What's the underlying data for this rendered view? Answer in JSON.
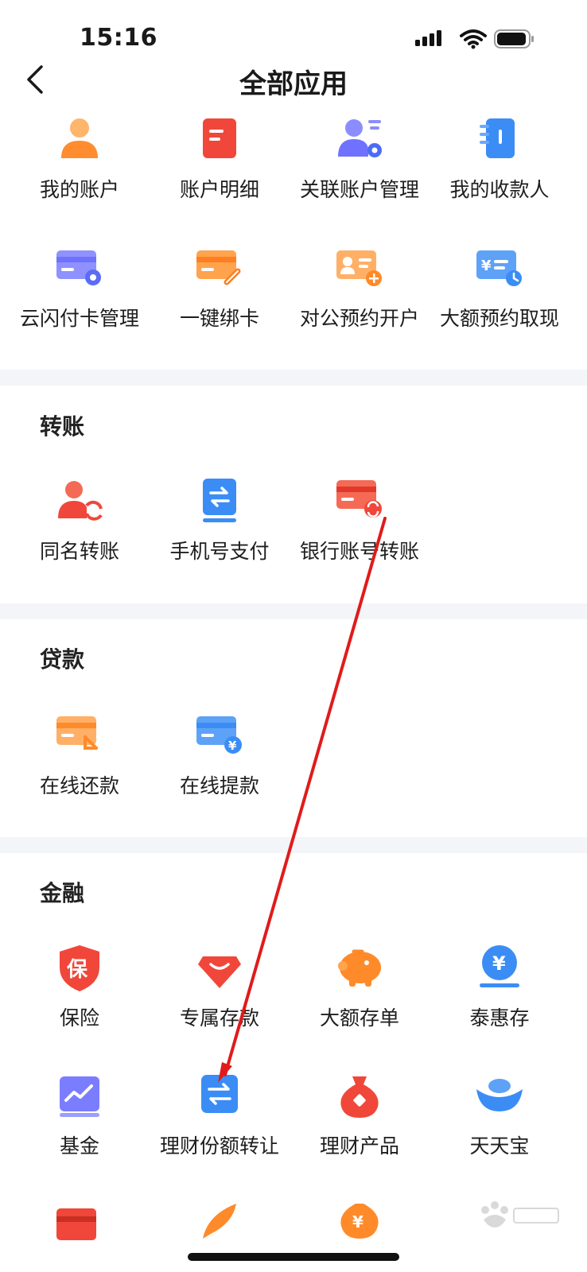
{
  "status_bar": {
    "time": "15:16"
  },
  "nav": {
    "title": "全部应用"
  },
  "account_section": {
    "items": [
      {
        "label": "我的账户",
        "icon": "person-icon",
        "color": "#ff9a3c"
      },
      {
        "label": "账户明细",
        "icon": "document-icon",
        "color": "#f0473a"
      },
      {
        "label": "关联账户管理",
        "icon": "user-gear-icon",
        "color": "#6f72ff"
      },
      {
        "label": "我的收款人",
        "icon": "contacts-book-icon",
        "color": "#3b8df5"
      },
      {
        "label": "云闪付卡管理",
        "icon": "card-gear-icon",
        "color": "#7b7dff"
      },
      {
        "label": "一键绑卡",
        "icon": "card-link-icon",
        "color": "#ff8a2a"
      },
      {
        "label": "对公预约开户",
        "icon": "id-card-add-icon",
        "color": "#ff9e45"
      },
      {
        "label": "大额预约取现",
        "icon": "cash-clock-icon",
        "color": "#3f8ff7"
      }
    ]
  },
  "transfer_section": {
    "title": "转账",
    "items": [
      {
        "label": "同名转账",
        "icon": "person-transfer-icon",
        "color": "#f0473a"
      },
      {
        "label": "手机号支付",
        "icon": "phone-transfer-icon",
        "color": "#3b8df5"
      },
      {
        "label": "银行账号转账",
        "icon": "card-transfer-icon",
        "color": "#f0473a"
      }
    ]
  },
  "loan_section": {
    "title": "贷款",
    "items": [
      {
        "label": "在线还款",
        "icon": "card-return-icon",
        "color": "#ff9a3c"
      },
      {
        "label": "在线提款",
        "icon": "card-yuan-icon",
        "color": "#3b8df5"
      }
    ]
  },
  "finance_section": {
    "title": "金融",
    "items": [
      {
        "label": "保险",
        "icon": "shield-insurance-icon",
        "color": "#f0473a"
      },
      {
        "label": "专属存款",
        "icon": "gem-icon",
        "color": "#f0473a"
      },
      {
        "label": "大额存单",
        "icon": "piggy-bank-icon",
        "color": "#ff8a2a"
      },
      {
        "label": "泰惠存",
        "icon": "yuan-coin-icon",
        "color": "#3b8df5"
      },
      {
        "label": "基金",
        "icon": "chart-line-icon",
        "color": "#7b7dff"
      },
      {
        "label": "理财份额转让",
        "icon": "exchange-icon",
        "color": "#3b8df5"
      },
      {
        "label": "理财产品",
        "icon": "money-bag-icon",
        "color": "#f0473a"
      },
      {
        "label": "天天宝",
        "icon": "gold-ingot-icon",
        "color": "#3b8df5"
      }
    ]
  }
}
